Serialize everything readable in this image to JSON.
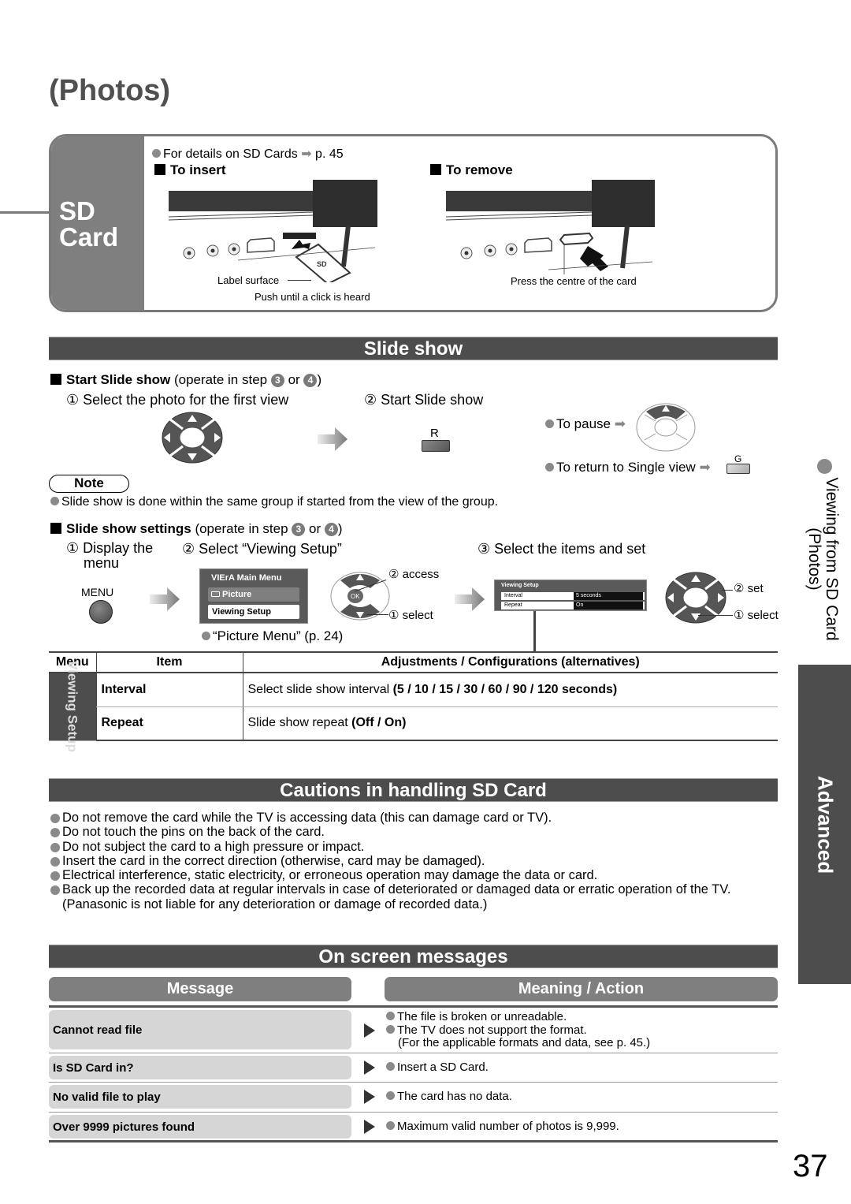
{
  "page": {
    "title": "(Photos)",
    "number": "37"
  },
  "sd_card": {
    "tab_label_line1": "SD",
    "tab_label_line2": "Card",
    "details_text": "For details on SD Cards",
    "details_arrow": "➡",
    "details_page": "p. 45",
    "insert": {
      "heading": "To insert",
      "label_surface": "Label surface",
      "push_text": "Push until a click is heard"
    },
    "remove": {
      "heading": "To remove",
      "press_text": "Press the centre of the card"
    }
  },
  "slide_show": {
    "bar_title": "Slide show",
    "start": {
      "heading_bold": "Start Slide show",
      "heading_rest": "(operate in step",
      "step_a": "3",
      "or": "or",
      "step_b": "4",
      "close": ")",
      "step1": "① Select the photo for the first view",
      "step2": "② Start Slide show",
      "r_button_label": "R",
      "to_pause": "To pause",
      "to_return": "To return to Single view",
      "g_button_label": "G"
    },
    "note": {
      "badge": "Note",
      "text": "Slide show is done within the same group if started from the view of the group."
    },
    "settings": {
      "heading_bold": "Slide show settings",
      "heading_rest": "(operate in step",
      "step_a": "3",
      "or": "or",
      "step_b": "4",
      "close": ")",
      "step1_line1": "① Display the",
      "step1_line2": "menu",
      "step2": "② Select “Viewing Setup”",
      "step3": "③ Select the items and set",
      "menu_button_label": "MENU",
      "main_menu": {
        "brand": "VIErA",
        "title": "Main Menu",
        "item_picture": "Picture",
        "item_viewing_setup": "Viewing Setup"
      },
      "ok_label": "OK",
      "access_label": "② access",
      "select_label": "① select",
      "picture_menu_ref": "“Picture Menu” (p. 24)",
      "viewing_setup_osd": {
        "title": "Viewing Setup",
        "rows": [
          {
            "label": "Interval",
            "value": "5 seconds"
          },
          {
            "label": "Repeat",
            "value": "On"
          }
        ]
      },
      "set_label": "② set",
      "select_label2": "① select"
    },
    "table": {
      "headers": [
        "Menu",
        "Item",
        "Adjustments / Configurations (alternatives)"
      ],
      "menu_group": "Viewing Setup",
      "rows": [
        {
          "item": "Interval",
          "desc": "Select slide show interval",
          "options": "(5 / 10 / 15 / 30 / 60 / 90 / 120 seconds)"
        },
        {
          "item": "Repeat",
          "desc": "Slide show repeat",
          "options": "(Off / On)"
        }
      ]
    }
  },
  "cautions": {
    "bar_title": "Cautions in handling SD Card",
    "items": [
      "Do not remove the card while the TV is accessing data (this can damage card or TV).",
      "Do not touch the pins on the back of the card.",
      "Do not subject the card to a high pressure or impact.",
      "Insert the card in the correct direction (otherwise, card may be damaged).",
      "Electrical interference, static electricity, or erroneous operation may damage the data or card.",
      "Back up the recorded data at regular intervals in case of deteriorated or damaged data or erratic operation of the TV. (Panasonic is not liable for any deterioration or damage of recorded data.)"
    ]
  },
  "messages": {
    "bar_title": "On screen messages",
    "col_message": "Message",
    "col_meaning": "Meaning / Action",
    "rows": [
      {
        "message": "Cannot read file",
        "lines": [
          "The file is broken or unreadable.",
          "The TV does not support the format."
        ],
        "extra": "(For the applicable formats and data, see p. 45.)"
      },
      {
        "message": "Is SD Card in?",
        "lines": [
          "Insert a SD Card."
        ]
      },
      {
        "message": "No valid file to play",
        "lines": [
          "The card has no data."
        ]
      },
      {
        "message": "Over 9999 pictures found",
        "lines": [
          "Maximum valid number of photos is 9,999."
        ]
      }
    ]
  },
  "side": {
    "viewing_line1": "Viewing from SD Card",
    "viewing_line2": "(Photos)",
    "advanced": "Advanced"
  }
}
